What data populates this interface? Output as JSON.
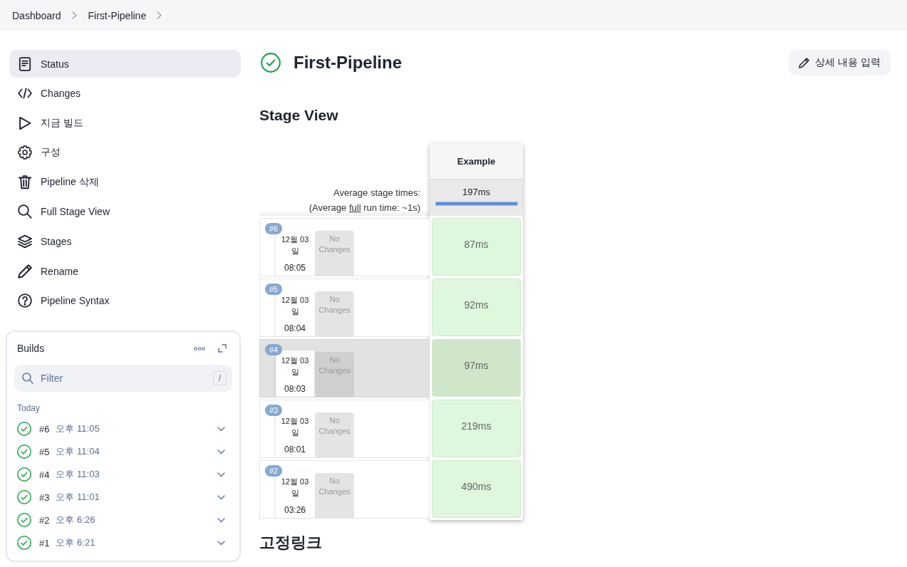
{
  "breadcrumbs": [
    {
      "label": "Dashboard"
    },
    {
      "label": "First-Pipeline"
    }
  ],
  "sidebar": {
    "items": [
      {
        "label": "Status",
        "kind": "document",
        "selected": true
      },
      {
        "label": "Changes",
        "kind": "code",
        "selected": false
      },
      {
        "label": "지금 빌드",
        "kind": "play",
        "selected": false
      },
      {
        "label": "구성",
        "kind": "gear",
        "selected": false
      },
      {
        "label": "Pipeline 삭제",
        "kind": "trash",
        "selected": false
      },
      {
        "label": "Full Stage View",
        "kind": "search",
        "selected": false
      },
      {
        "label": "Stages",
        "kind": "layers",
        "selected": false
      },
      {
        "label": "Rename",
        "kind": "pencil",
        "selected": false
      },
      {
        "label": "Pipeline Syntax",
        "kind": "help",
        "selected": false
      }
    ]
  },
  "builds": {
    "title": "Builds",
    "filter": {
      "placeholder": "Filter",
      "shortcut": "/"
    },
    "group": "Today",
    "items": [
      {
        "number": "#6",
        "time": "오후 11:05",
        "kind": "success"
      },
      {
        "number": "#5",
        "time": "오후 11:04",
        "kind": "success"
      },
      {
        "number": "#4",
        "time": "오후 11:03",
        "kind": "success"
      },
      {
        "number": "#3",
        "time": "오후 11:01",
        "kind": "success"
      },
      {
        "number": "#2",
        "time": "오후 6:26",
        "kind": "success"
      },
      {
        "number": "#1",
        "time": "오후 6:21",
        "kind": "success"
      }
    ]
  },
  "header": {
    "title": "First-Pipeline",
    "kind": "success",
    "button": "상세 내용 입력"
  },
  "stage_view": {
    "title": "Stage View",
    "average_label": "Average stage times:",
    "full_run": {
      "before": "(Average",
      "link": "full",
      "after": "run time: ~1s)"
    },
    "stages": [
      {
        "name": "Example",
        "average": "197ms",
        "level": 1
      }
    ],
    "runs": [
      {
        "number": "#6",
        "date": "12월 03일",
        "time": "08:05",
        "changes": "No Changes",
        "selected": false,
        "results": [
          {
            "duration": "87ms",
            "kind": "success"
          }
        ]
      },
      {
        "number": "#5",
        "date": "12월 03일",
        "time": "08:04",
        "changes": "No Changes",
        "selected": false,
        "results": [
          {
            "duration": "92ms",
            "kind": "success"
          }
        ]
      },
      {
        "number": "#4",
        "date": "12월 03일",
        "time": "08:03",
        "changes": "No Changes",
        "selected": true,
        "results": [
          {
            "duration": "97ms",
            "kind": "success"
          }
        ]
      },
      {
        "number": "#3",
        "date": "12월 03일",
        "time": "08:01",
        "changes": "No Changes",
        "selected": false,
        "results": [
          {
            "duration": "219ms",
            "kind": "success"
          }
        ]
      },
      {
        "number": "#2",
        "date": "12월 03일",
        "time": "03:26",
        "changes": "No Changes",
        "selected": false,
        "results": [
          {
            "duration": "490ms",
            "kind": "success"
          }
        ]
      }
    ]
  },
  "permalinks": {
    "title": "고정링크"
  }
}
